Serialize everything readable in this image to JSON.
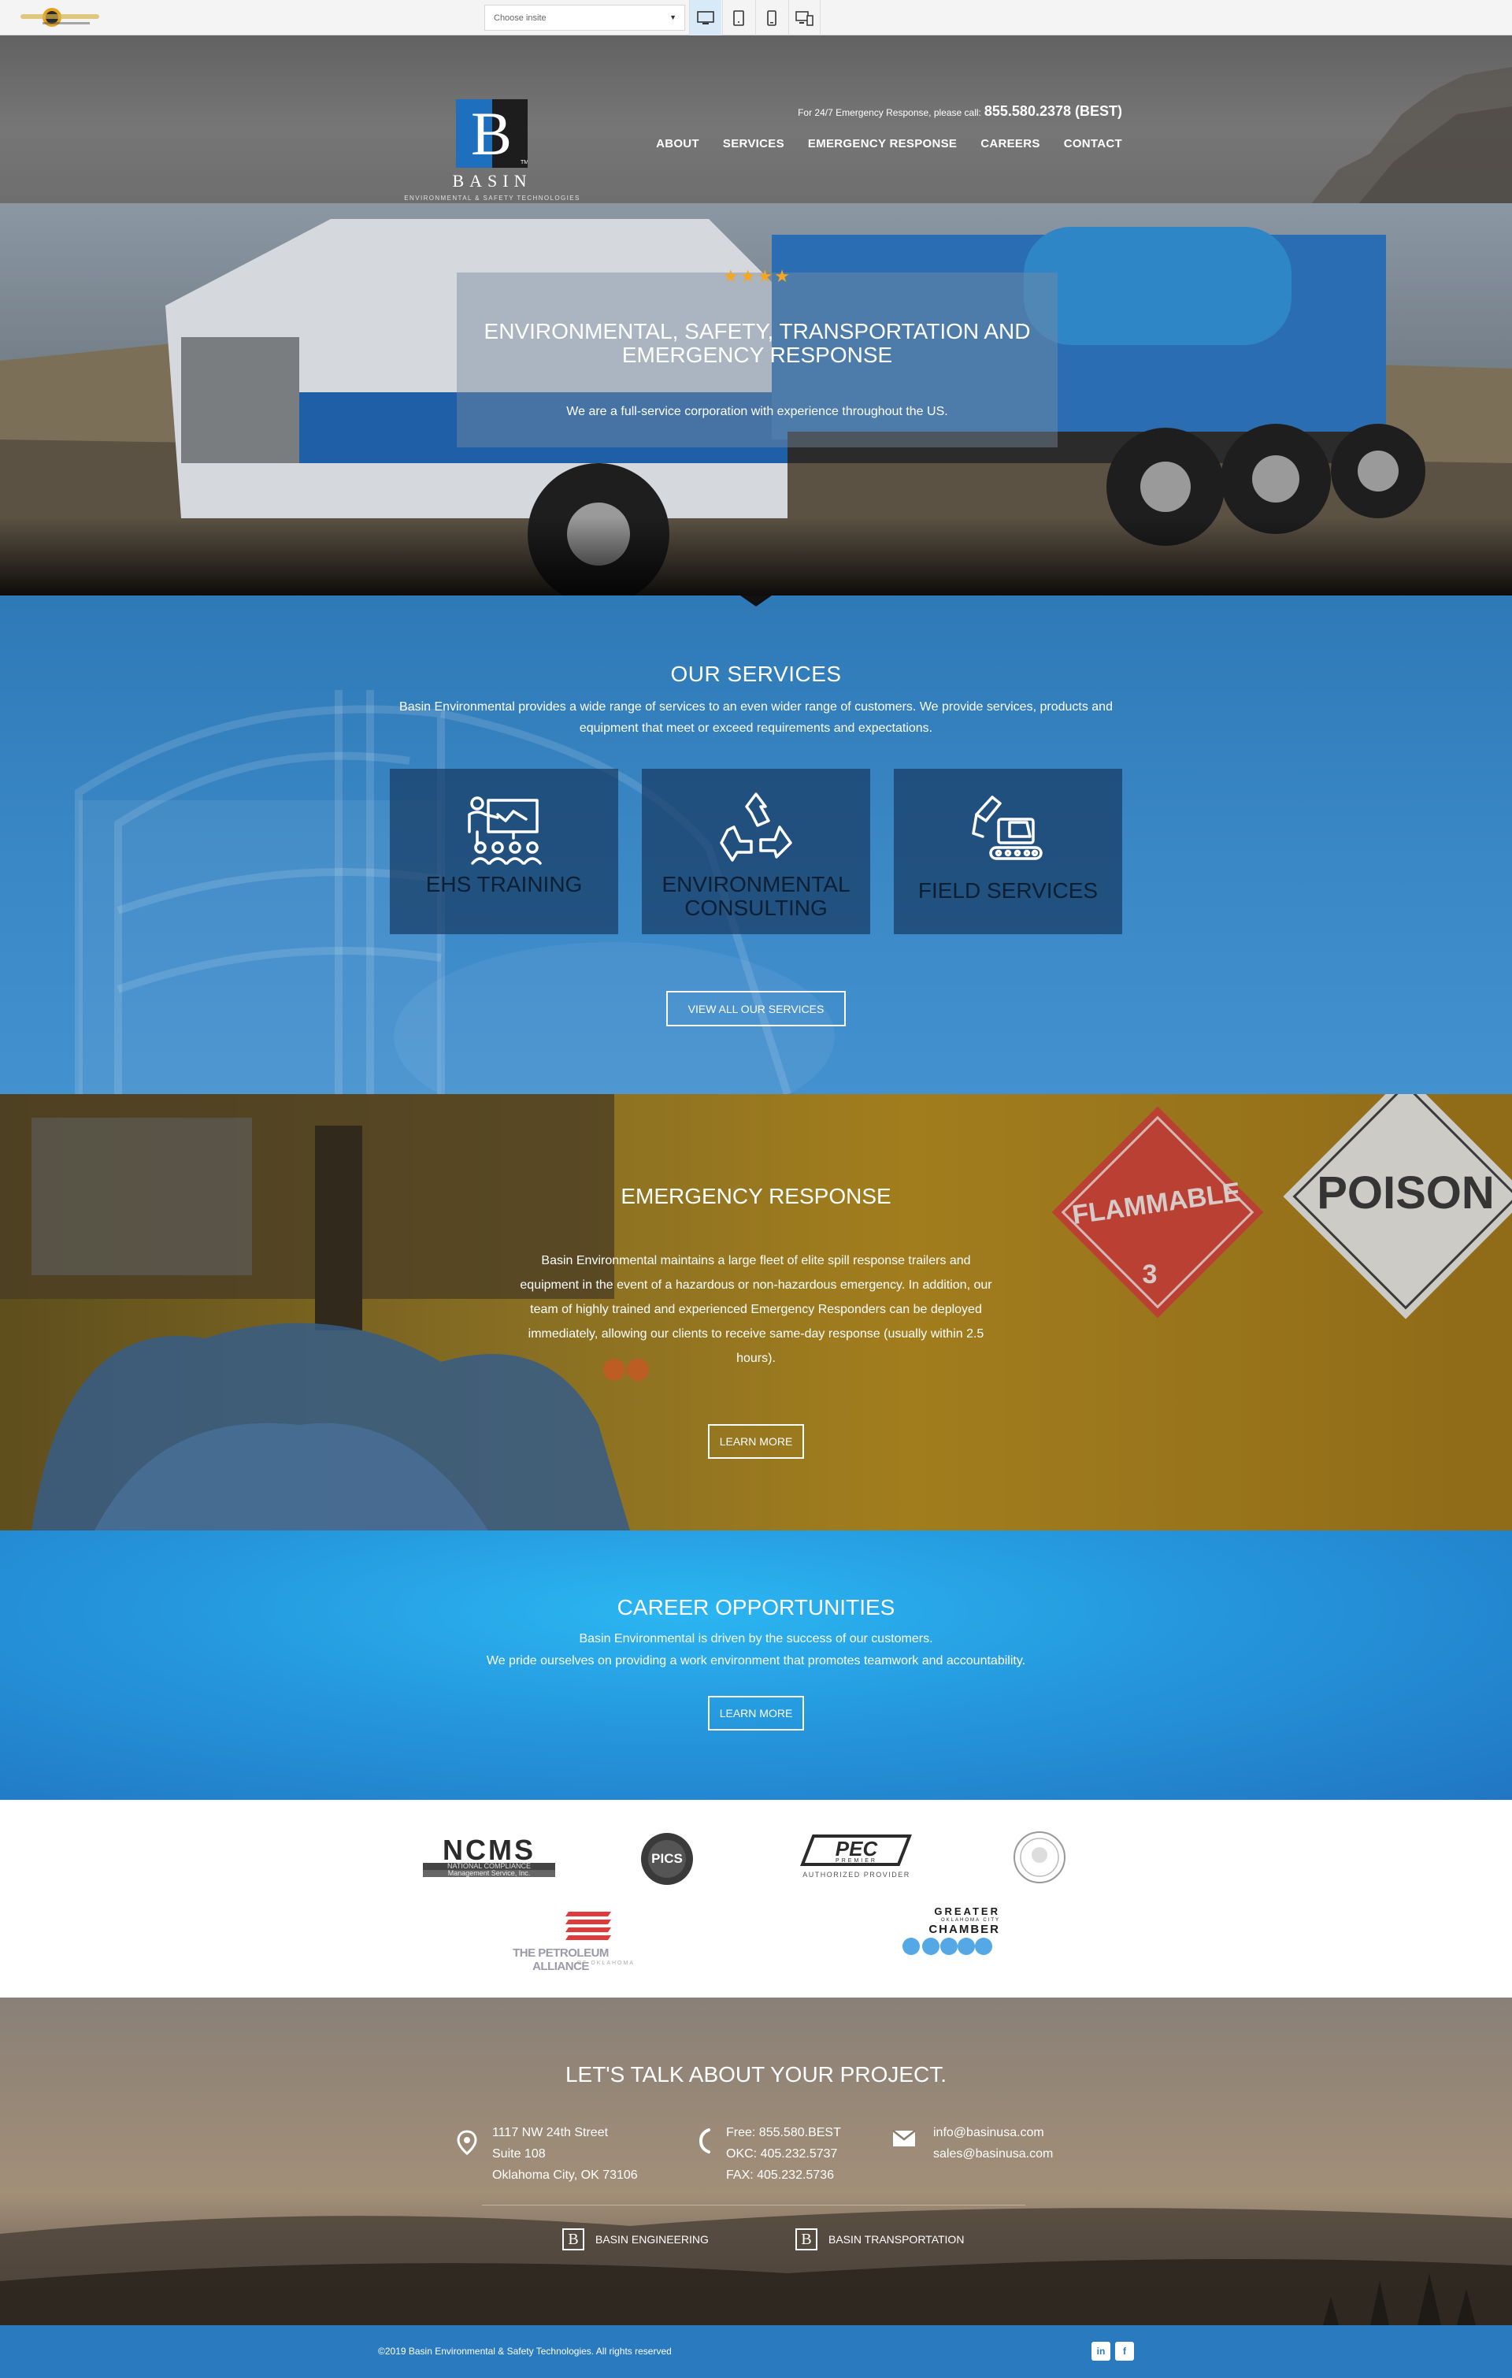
{
  "toolbar": {
    "select_placeholder": "Choose insite"
  },
  "header": {
    "logo_name": "BASIN",
    "logo_tagline": "ENVIRONMENTAL & SAFETY TECHNOLOGIES",
    "call_text": "For 24/7 Emergency Response, please call:",
    "phone": "855.580.2378 (BEST)",
    "nav": [
      "ABOUT",
      "SERVICES",
      "EMERGENCY RESPONSE",
      "CAREERS",
      "CONTACT"
    ]
  },
  "hero": {
    "stars": "★★★★",
    "title": "ENVIRONMENTAL, SAFETY, TRANSPORTATION AND EMERGENCY RESPONSE",
    "subtitle": "We are a full-service corporation with experience throughout the US."
  },
  "services": {
    "title": "OUR SERVICES",
    "description": "Basin Environmental provides a wide range of services to an even wider range of customers. We provide services, products and equipment that meet or exceed requirements and expectations.",
    "cards": [
      {
        "label": "EHS TRAINING",
        "icon": "training-icon"
      },
      {
        "label": "ENVIRONMENTAL CONSULTING",
        "icon": "recycle-icon"
      },
      {
        "label": "FIELD SERVICES",
        "icon": "excavator-icon"
      }
    ],
    "button": "VIEW ALL OUR SERVICES"
  },
  "emergency": {
    "title": "EMERGENCY RESPONSE",
    "description": "Basin Environmental maintains a large fleet of elite spill response trailers and equipment in the event of a hazardous or non-hazardous emergency. In addition, our team of highly trained and experienced Emergency Responders can be deployed immediately, allowing our clients to receive same-day response (usually within 2.5 hours).",
    "button": "LEARN MORE"
  },
  "careers": {
    "title": "CAREER OPPORTUNITIES",
    "line1": "Basin Environmental is driven by the success of our customers.",
    "line2": "We pride ourselves on providing a work environment that promotes teamwork and accountability.",
    "button": "LEARN MORE"
  },
  "partners": {
    "ncms_big": "NCMS",
    "ncms_small1": "NATIONAL COMPLIANCE",
    "ncms_small2": "Management Service, Inc.",
    "pics": "PICS",
    "pec": "PEC",
    "pec_premier": "PREMIER",
    "pec_sub": "AUTHORIZED PROVIDER",
    "petroleum": "THE PETROLEUM ALLIANCE",
    "petroleum_sub": "OF OKLAHOMA",
    "chamber_1": "GREATER",
    "chamber_2": "OKLAHOMA CITY",
    "chamber_3": "CHAMBER"
  },
  "contact": {
    "title": "LET'S TALK ABOUT YOUR PROJECT.",
    "address": [
      "1117 NW 24th Street",
      "Suite 108",
      "Oklahoma City, OK 73106"
    ],
    "phones": [
      "Free: 855.580.BEST",
      "OKC: 405.232.5737",
      "FAX: 405.232.5736"
    ],
    "emails": [
      "info@basinusa.com",
      "sales@basinusa.com"
    ],
    "links": [
      "BASIN ENGINEERING",
      "BASIN TRANSPORTATION"
    ]
  },
  "footer": {
    "copyright": "©2019 Basin Environmental & Safety Technologies. All rights reserved",
    "social": [
      "in",
      "f"
    ]
  }
}
